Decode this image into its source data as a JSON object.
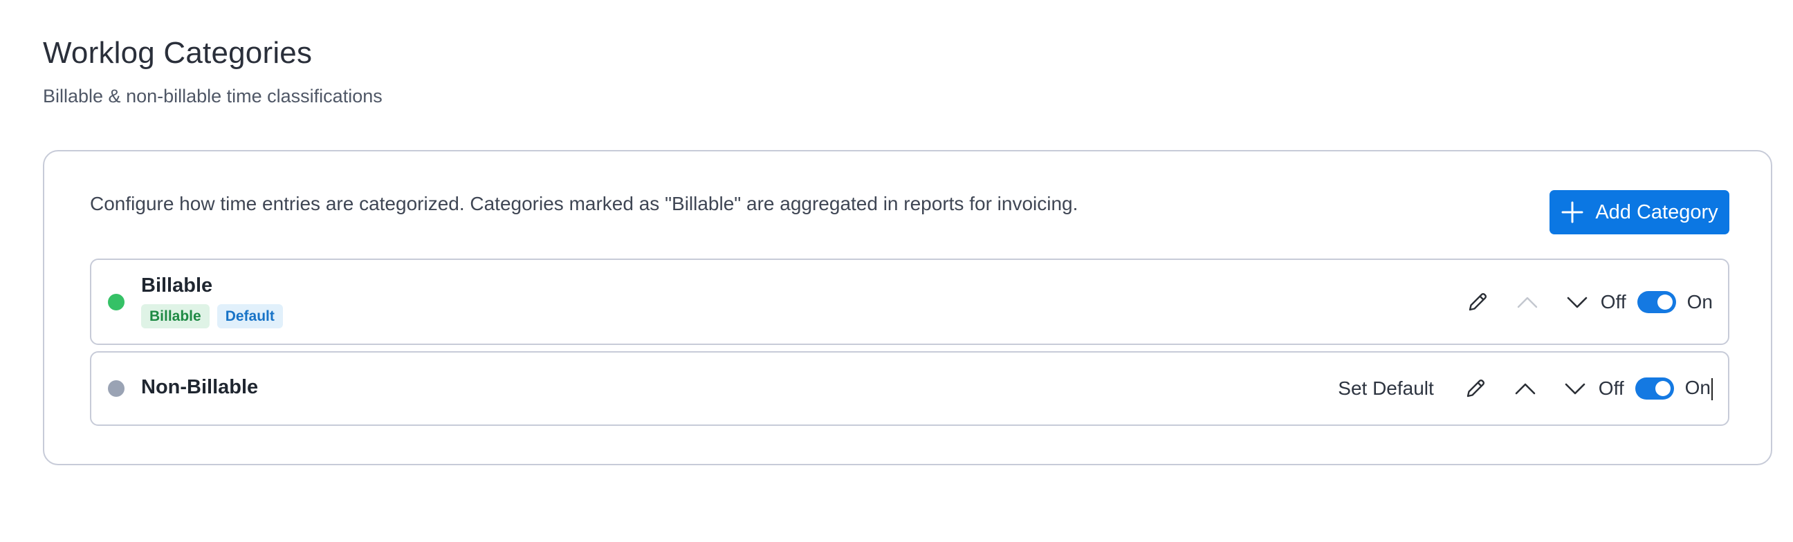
{
  "page": {
    "title": "Worklog Categories",
    "subtitle": "Billable & non-billable time classifications"
  },
  "card": {
    "description": "Configure how time entries are categorized. Categories marked as \"Billable\" are aggregated in reports for invoicing.",
    "add_button_label": "Add Category",
    "add_button_icon": "plus-icon"
  },
  "categories": [
    {
      "name": "Billable",
      "dot_color": "#35c166",
      "badges": [
        "Billable",
        "Default"
      ],
      "set_default_label": "",
      "toggle_off_label": "Off",
      "toggle_on_label": "On",
      "enabled": true,
      "move_up_disabled": true
    },
    {
      "name": "Non-Billable",
      "dot_color": "#9aa3b4",
      "badges": [],
      "set_default_label": "Set Default",
      "toggle_off_label": "Off",
      "toggle_on_label": "On",
      "enabled": true,
      "move_up_disabled": false
    }
  ],
  "colors": {
    "accent": "#0b77e3",
    "toggle_on": "#1479e2",
    "border": "#c7cbd8",
    "badge_billable_bg": "#dff3e6",
    "badge_billable_text": "#1e8a44",
    "badge_default_bg": "#e1f0fb",
    "badge_default_text": "#1773c7"
  },
  "icons": {
    "edit": "pencil-icon",
    "move_up": "chevron-up-icon",
    "move_down": "chevron-down-icon",
    "status": "status-dot-icon"
  }
}
